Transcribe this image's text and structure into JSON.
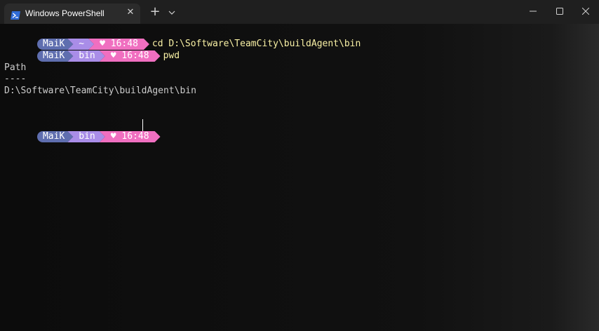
{
  "window": {
    "tab_title": "Windows PowerShell",
    "tab_close": "✕",
    "new_tab": "+",
    "icons": [
      "powershell-icon",
      "close-icon",
      "plus-icon",
      "chevron-down-icon",
      "minimize-icon",
      "maximize-icon",
      "close-icon"
    ]
  },
  "prompts": [
    {
      "user": "MaiK",
      "dir": "~",
      "time": "♥ 16:48",
      "command": "cd D:\\Software\\TeamCity\\buildAgent\\bin"
    },
    {
      "user": "MaiK",
      "dir": "bin",
      "time": "♥ 16:48",
      "command": "pwd"
    },
    {
      "user": "MaiK",
      "dir": "bin",
      "time": "♥ 16:48",
      "command": ""
    }
  ],
  "output": {
    "header": "Path",
    "underline": "----",
    "path": "D:\\Software\\TeamCity\\buildAgent\\bin"
  },
  "colors": {
    "user_segment": "#5f6eaf",
    "dir_segment": "#a98de8",
    "time_segment": "#f06fc0",
    "command_text": "#f9f1a5",
    "output_text": "#cccccc"
  }
}
